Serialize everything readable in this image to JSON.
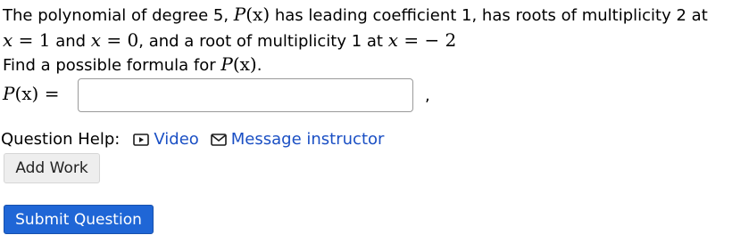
{
  "question": {
    "line1_text_a": "The polynomial of degree 5, ",
    "line1_math_p": "P",
    "line1_math_x": "(x)",
    "line1_text_b": " has leading coefficient 1, has roots of multiplicity 2 at",
    "line2_math_x1": "x",
    "line2_math_eq1": " = 1",
    "line2_text_and": " and ",
    "line2_math_x2": "x",
    "line2_math_eq2": " = 0",
    "line2_text_b": ", and a root of multiplicity 1 at ",
    "line2_math_x3": "x",
    "line2_math_eq3": " =  − 2",
    "line3_text": "Find a possible formula for ",
    "line3_math_p": "P",
    "line3_math_x": "(x)",
    "line3_period": "."
  },
  "answer": {
    "label_p": "P",
    "label_x": "(x)",
    "label_eq": " = ",
    "input_value": "",
    "after_text": ","
  },
  "help": {
    "label": "Question Help:",
    "video_label": "Video",
    "message_label": "Message instructor",
    "link_color": "#1a4fc4"
  },
  "buttons": {
    "add_work_label": "Add Work",
    "submit_label": "Submit Question",
    "submit_color": "#1f66d6"
  }
}
